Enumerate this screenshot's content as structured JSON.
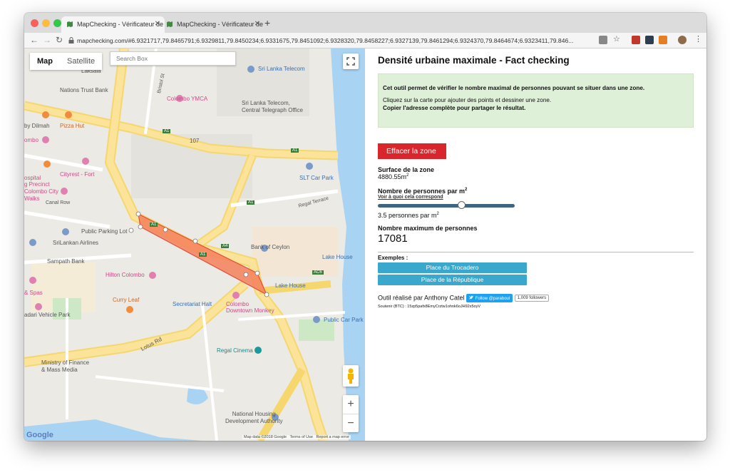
{
  "browser": {
    "tabs": [
      {
        "title": "MapChecking - Vérificateur de",
        "active": true
      },
      {
        "title": "MapChecking - Vérificateur de",
        "active": false
      }
    ],
    "new_tab_symbol": "+",
    "url": "mapchecking.com/#6.9321717,79.8465791;6.9329811,79.8450234;6.9331675,79.8451092;6.9328320,79.8458227;6.9327139,79.8461294;6.9324370,79.8464674;6.9323411,79.846..."
  },
  "map": {
    "map_type_map": "Map",
    "map_type_satellite": "Satellite",
    "search_placeholder": "Search Box",
    "labels": {
      "sri_lanka_telecom": "Sri Lanka Telecom",
      "laksala": "Laksala",
      "nations_trust_bank": "Nations Trust Bank",
      "bristol_st": "Bristol St",
      "colombo_ymca": "Colombo YMCA",
      "slt_central": "Sri Lanka Telecom,\nCentral Telegraph Office",
      "by_dilmah": "by Dilmah",
      "pizza_hut": "Pizza Hut",
      "ombo": "ombo",
      "route_107": "107",
      "a1_1": "A1",
      "a1_2": "A1",
      "a1_3": "A1",
      "a1_4": "A1",
      "a1_5": "A1",
      "a4": "A4",
      "ac6": "AC6",
      "slt_car_park": "SLT Car Park",
      "cityrest": "Cityrest - Fort",
      "ospital": "ospital",
      "g_precinct": "g Precinct",
      "colombo_city": "Colombo City",
      "walks": "Walks",
      "canal_row": "Canal Row",
      "regal_terrace": "Regal Terrace",
      "public_parking": "Public Parking Lot",
      "srilankan_airlines": "SriLankan Airlines",
      "bank_of_ceylon": "Bank of Ceylon",
      "lake_house_1": "Lake House",
      "lake_house_2": "Lake House",
      "sampath_bank": "Sampath Bank",
      "hilton": "Hilton Colombo",
      "spas": "& Spas",
      "curry_leaf": "Curry Leaf",
      "secretariat": "Secretariat Halt",
      "downtown_monkey": "Colombo\nDowntown Monkey",
      "vehicle_park": "adari Vehicle Park",
      "public_car_park": "Public Car Park",
      "lotus_rd": "Lotus Rd",
      "regal_cinema": "Regal Cinema",
      "ministry": "Ministry of Finance\n& Mass Media",
      "national_housing": "National Housing\nDevelopment Authority",
      "google": "Google",
      "map_data": "Map data ©2018 Google",
      "terms": "Terms of Use",
      "report": "Report a map error"
    },
    "zoom_in": "+",
    "zoom_out": "−"
  },
  "panel": {
    "title": "Densité urbaine maximale - Fact checking",
    "info_line1": "Cet outil permet de vérifier le nombre maximal de personnes pouvant se situer dans une zone.",
    "info_line2": "Cliquez sur la carte pour ajouter des points et dessiner une zone.",
    "info_line3": "Copier l'adresse complète pour partager le résultat.",
    "clear_button": "Effacer la zone",
    "surface_label": "Surface de la zone",
    "surface_value": "4880.55m",
    "surface_exp": "2",
    "density_label": "Nombre de personnes par m",
    "density_exp": "2",
    "density_link": "Voir à quoi cela correspond",
    "density_value": "3.5 personnes par m",
    "density_fraction": 0.62,
    "max_label": "Nombre maximum de personnes",
    "max_value": "17081",
    "examples_label": "Exemples :",
    "example1": "Place du Trocadero",
    "example2": "Place de la République",
    "author": "Outil réalisé par Anthony Catel",
    "follow_btn": "Follow @paraboul",
    "followers": "1,009 followers",
    "support": "Soutenir (BTC) : 15zp5pafx8EmyCrztw1ohnk6oJH92x5oyV"
  }
}
